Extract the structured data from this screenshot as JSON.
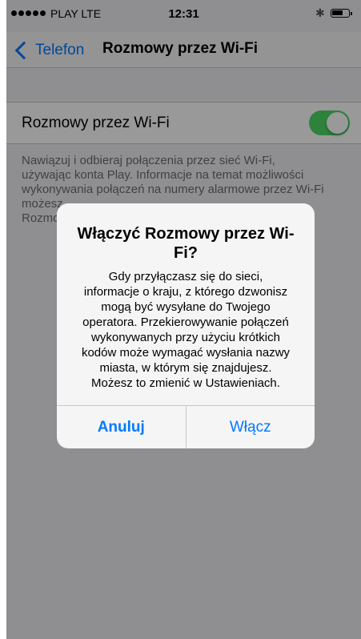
{
  "status_bar": {
    "carrier": "PLAY",
    "network": "LTE",
    "time": "12:31"
  },
  "nav": {
    "back_label": "Telefon",
    "title": "Rozmowy przez Wi-Fi"
  },
  "setting": {
    "label": "Rozmowy przez Wi-Fi",
    "enabled": true,
    "footer_lines": [
      "Nawiązuj i odbieraj połączenia przez sieć Wi-Fi,",
      "używając konta Play. Informacje na temat możliwości",
      "wykonywania połączeń na numery alarmowe przez Wi-Fi",
      "możesz",
      "Rozmo"
    ]
  },
  "alert": {
    "title": "Włączyć Rozmowy przez Wi-Fi?",
    "message_lines": [
      "Gdy przyłączasz się do sieci,",
      "informacje o kraju, z którego dzwonisz",
      "mogą być wysyłane do Twojego",
      "operatora. Przekierowywanie połączeń",
      "wykonywanych przy użyciu krótkich",
      "kodów może wymagać wysłania nazwy",
      "miasta, w którym się znajdujesz.",
      "Możesz to zmienić w Ustawieniach."
    ],
    "cancel_label": "Anuluj",
    "confirm_label": "Włącz"
  },
  "colors": {
    "tint": "#007aff",
    "toggle_on": "#4cd964"
  }
}
